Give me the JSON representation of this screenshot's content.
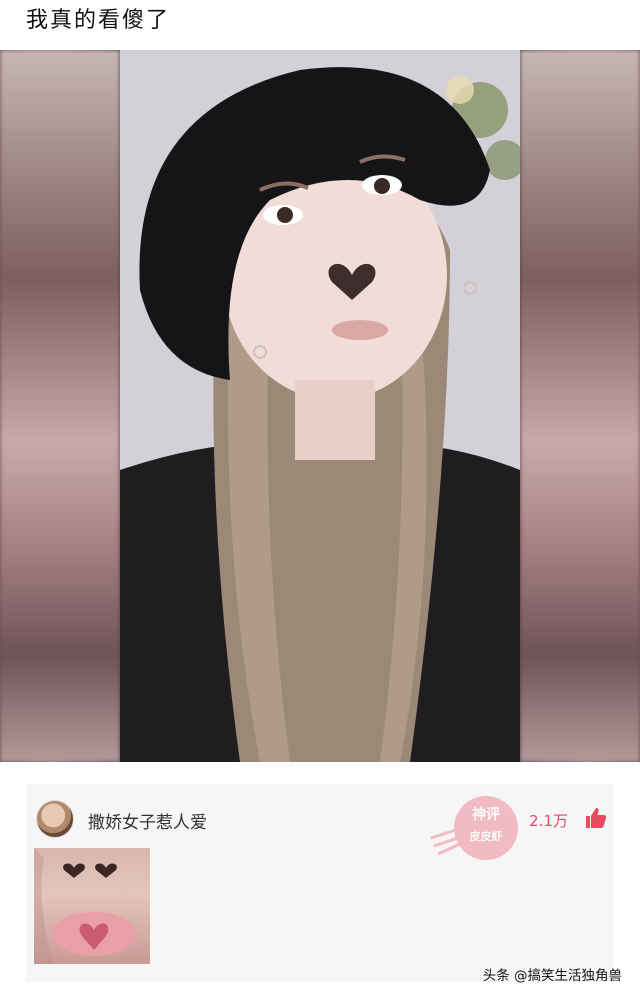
{
  "post": {
    "title": "我真的看傻了"
  },
  "comment": {
    "username": "撒娇女子惹人爱",
    "likes": "2.1万",
    "stamp_top": "神评",
    "stamp_bottom": "皮皮虾"
  },
  "footer": {
    "watermark": "头条 @搞笑生活独角兽"
  },
  "colors": {
    "like_accent": "#e84a5f",
    "stamp_accent": "#f08a9a"
  },
  "icons": {
    "like": "thumbs-up-icon",
    "avatar": "avatar-image"
  }
}
